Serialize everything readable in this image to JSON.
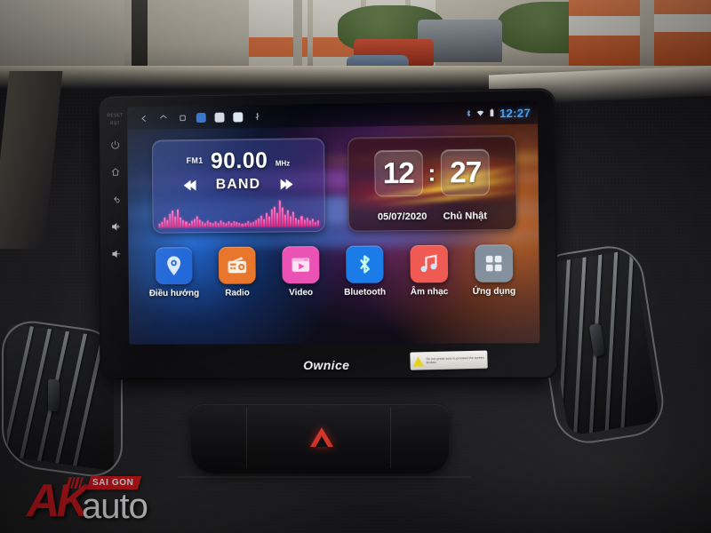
{
  "scene": {
    "description": "Car dashboard photo with Ownice Android head unit",
    "watermark": {
      "brand": "AK",
      "sub": "auto",
      "region": "SAI GON"
    }
  },
  "head_unit": {
    "brand_label": "Ownice",
    "warning_label": "Do not press sure to proceed the screen broken",
    "side_buttons": [
      {
        "name": "reset-label",
        "label": "RESET"
      },
      {
        "name": "reset-pin-label",
        "label": "RST"
      },
      {
        "name": "power-button",
        "label": "Power"
      },
      {
        "name": "home-button",
        "label": "Home"
      },
      {
        "name": "back-button",
        "label": "Back"
      },
      {
        "name": "volume-up-button",
        "label": "Volume Up"
      },
      {
        "name": "volume-down-button",
        "label": "Volume Down"
      }
    ]
  },
  "screen": {
    "status_bar": {
      "nav": [
        {
          "name": "back",
          "icon": "chevron-left-icon"
        },
        {
          "name": "home",
          "icon": "home-icon"
        },
        {
          "name": "recents",
          "icon": "square-icon"
        }
      ],
      "mini_apps": [
        {
          "name": "app-shortcut-1",
          "color": "#2a6fc9"
        },
        {
          "name": "app-shortcut-2",
          "color": "#cfd8e4"
        },
        {
          "name": "app-shortcut-3",
          "color": "#dce6f2"
        }
      ],
      "usb_icon": "usb-icon",
      "bluetooth_icon": "bluetooth-icon",
      "wifi_icon": "wifi-icon",
      "battery_icon": "battery-icon",
      "time": "12:27",
      "time_color": "#4ea8f5"
    },
    "radio_widget": {
      "band_label": "FM1",
      "frequency": "90.00",
      "unit": "MHz",
      "band_button": "BAND",
      "prev_icon": "seek-prev-icon",
      "next_icon": "seek-next-icon",
      "spectrum_color": "#e0247e",
      "spectrum_levels": [
        18,
        24,
        40,
        30,
        52,
        66,
        44,
        70,
        40,
        30,
        24,
        18,
        26,
        34,
        44,
        30,
        22,
        18,
        26,
        20,
        16,
        22,
        18,
        26,
        20,
        16,
        22,
        18,
        24,
        20,
        16,
        14,
        18,
        22,
        16,
        20,
        26,
        34,
        44,
        30,
        52,
        40,
        66,
        78,
        54,
        100,
        72,
        48,
        62,
        40,
        56,
        34,
        26,
        40,
        28,
        34,
        22,
        30,
        18,
        24
      ]
    },
    "clock_widget": {
      "hours": "12",
      "minutes": "27",
      "separator": ":",
      "date": "05/07/2020",
      "weekday": "Chủ Nhật"
    },
    "apps": [
      {
        "name": "navigation",
        "label": "Điều hướng",
        "icon": "map-pin-icon",
        "color": "#1f66d8"
      },
      {
        "name": "radio",
        "label": "Radio",
        "icon": "radio-icon",
        "color": "#e8762c"
      },
      {
        "name": "video",
        "label": "Video",
        "icon": "video-play-icon",
        "color": "#ea53b5"
      },
      {
        "name": "bluetooth",
        "label": "Bluetooth",
        "icon": "bluetooth-icon",
        "color": "#1b7ce8"
      },
      {
        "name": "music",
        "label": "Âm nhạc",
        "icon": "music-note-icon",
        "color": "#ef5a52"
      },
      {
        "name": "apps",
        "label": "Ứng dụng",
        "icon": "grid-apps-icon",
        "color": "#7f8c99"
      }
    ]
  },
  "dashboard": {
    "hazard_button": {
      "name": "hazard-button",
      "icon": "hazard-triangle-icon",
      "color": "#ec3c30"
    },
    "vents": [
      {
        "name": "left-air-vent"
      },
      {
        "name": "right-air-vent"
      }
    ]
  }
}
